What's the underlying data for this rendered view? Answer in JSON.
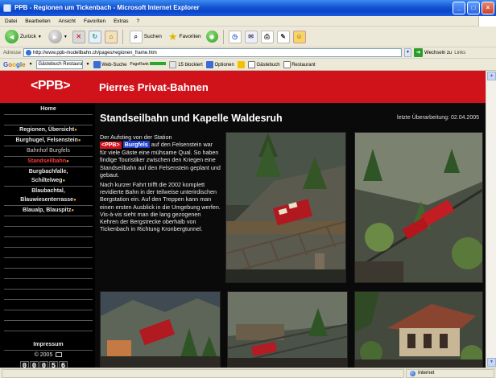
{
  "window": {
    "title": "PPB - Regionen um Tickenbach - Microsoft Internet Explorer"
  },
  "menu": [
    "Datei",
    "Bearbeiten",
    "Ansicht",
    "Favoriten",
    "Extras",
    "?"
  ],
  "toolbar": {
    "back": "Zurück",
    "search": "Suchen",
    "favorites": "Favoriten"
  },
  "address": {
    "label": "Adresse",
    "url": "http://www.ppb-modellbahn.ch/pages/regionen_frame.htm",
    "go": "Wechseln zu",
    "links": "Links"
  },
  "googlebar": {
    "logo": "Google",
    "query": "Gästebuch Restaurant",
    "web_search": "Web-Suche",
    "pagerank": "PageRank",
    "blocked": "15 blockiert",
    "options": "Optionen",
    "guestbook": "Gästebuch",
    "restaurant": "Restaurant"
  },
  "site": {
    "logo": "<PPB>",
    "title": "Pierres Privat-Bahnen"
  },
  "nav": {
    "home": "Home",
    "items": [
      {
        "label": "Regionen, Übersicht",
        "dot": true
      },
      {
        "label": "Burghugel, Felsenstein",
        "dot": true
      },
      {
        "label": "Bahnhof Burgfels",
        "dot": false
      },
      {
        "label": "Standseilbahn",
        "dot": true
      },
      {
        "label": "Burgbachfalle,",
        "dot": false
      },
      {
        "label": "Schiltelweg",
        "dot": true
      },
      {
        "label": "Blaubachtal,",
        "dot": false
      },
      {
        "label": "Blauwiesenterrasse",
        "dot": true
      },
      {
        "label": "Blaualp, Blauspitz",
        "dot": true
      }
    ],
    "impressum": "Impressum",
    "copyright": "© 2005",
    "counter": [
      "0",
      "0",
      "0",
      "5",
      "6"
    ]
  },
  "content": {
    "heading": "Standseilbahn und Kapelle Waldesruh",
    "updated": "letzte Überarbeitung: 02.04.2005",
    "p1_pre": "Der Aufstieg von der Station",
    "badge": "<PPB>",
    "station": "Burgfels",
    "p1_post": "auf den Felsenstein war für viele Gäste eine mühsame Qual. So haben findige Touristiker zwischen den Kriegen eine Standseilbahn auf den Felsenstein geplant und gebaut.",
    "p2": "Nach kurzer Fahrt trifft die 2002 komplett revidierte Bahn in der teilweise unterirdischen Bergstation ein. Auf den Treppen kann man einen ersten Ausblick in die Umgebung werfen. Vis-à-vis sieht man die lang gezogenen Kehren der Bergstrecke oberhalb von Tickenbach in Richtung Kronbergtunnel."
  },
  "status": {
    "zone": "Internet"
  }
}
